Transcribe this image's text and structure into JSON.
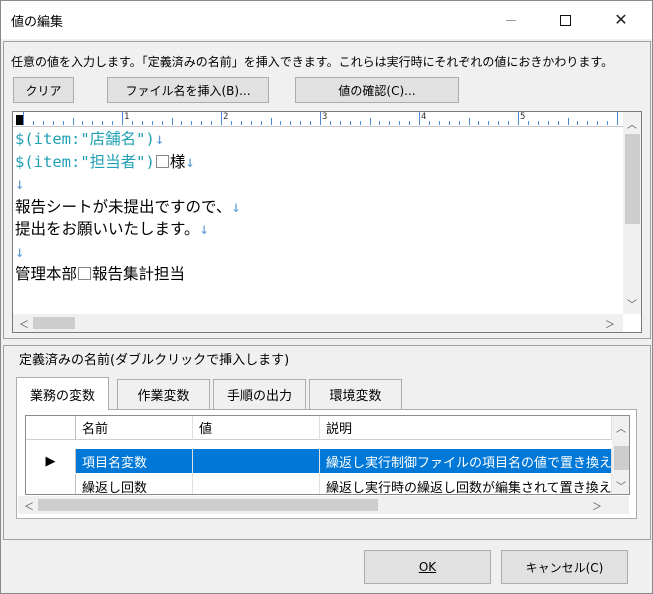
{
  "window": {
    "title": "値の編集"
  },
  "instruction": "任意の値を入力します。「定義済みの名前」を挿入できます。これらは実行時にそれぞれの値におきかわります。",
  "toolbar": {
    "clear_label": "クリア",
    "insert_filename_label": "ファイル名を挿入(B)...",
    "confirm_value_label": "値の確認(C)..."
  },
  "ruler": {
    "numbers": [
      "1",
      "2",
      "3",
      "4",
      "5"
    ]
  },
  "editor": {
    "lines": [
      {
        "parts": [
          {
            "text": "$(item:\"店舗名\")",
            "style": "teal"
          },
          {
            "text": "↓",
            "style": "mark"
          }
        ]
      },
      {
        "parts": [
          {
            "text": "$(item:\"担当者\")",
            "style": "teal"
          },
          {
            "text": "□",
            "style": "space"
          },
          {
            "text": "様",
            "style": "plain"
          },
          {
            "text": "↓",
            "style": "mark"
          }
        ]
      },
      {
        "parts": [
          {
            "text": "↓",
            "style": "mark"
          }
        ]
      },
      {
        "parts": [
          {
            "text": "報告シートが未提出ですので、",
            "style": "plain"
          },
          {
            "text": "↓",
            "style": "mark"
          }
        ]
      },
      {
        "parts": [
          {
            "text": "提出をお願いいたします。",
            "style": "plain"
          },
          {
            "text": "↓",
            "style": "mark"
          }
        ]
      },
      {
        "parts": [
          {
            "text": "↓",
            "style": "mark"
          }
        ]
      },
      {
        "parts": [
          {
            "text": "管理本部",
            "style": "plain"
          },
          {
            "text": "□",
            "style": "space"
          },
          {
            "text": "報告集計担当",
            "style": "plain"
          }
        ]
      }
    ]
  },
  "defined_names": {
    "group_label": "定義済みの名前(ダブルクリックで挿入します)",
    "tabs": [
      {
        "label": "業務の変数",
        "active": true
      },
      {
        "label": "作業変数",
        "active": false
      },
      {
        "label": "手順の出力",
        "active": false
      },
      {
        "label": "環境変数",
        "active": false
      }
    ],
    "columns": {
      "name": "名前",
      "value": "値",
      "description": "説明"
    },
    "rows": [
      {
        "name": "項目名変数",
        "value": "",
        "description": "繰返し実行制御ファイルの項目名の値で置き換えます",
        "selected": true,
        "marker": "▶"
      },
      {
        "name": "繰返し回数",
        "value": "",
        "description": "繰返し実行時の繰返し回数が編集されて置き換えます",
        "selected": false,
        "marker": ""
      }
    ]
  },
  "footer": {
    "ok_label": "OK",
    "cancel_label": "キャンセル(C)"
  },
  "colors": {
    "accent": "#0078d7",
    "variable_text": "#21a0b5",
    "newline_mark": "#5b9bd5"
  }
}
